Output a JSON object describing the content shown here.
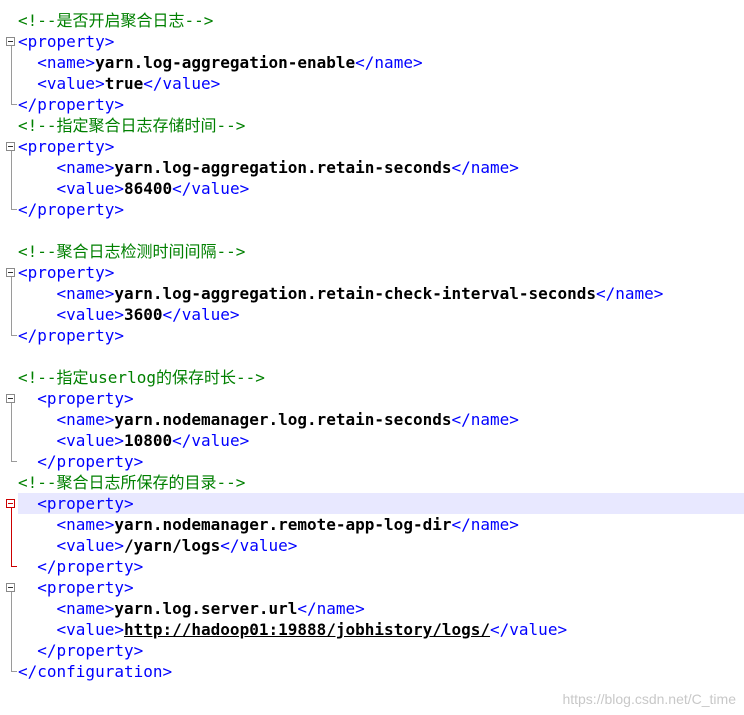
{
  "editor": {
    "lines": [
      {
        "kind": "comment",
        "indent": "",
        "text": "<!--是否开启聚合日志-->"
      },
      {
        "kind": "tag",
        "indent": "",
        "text": "<property>"
      },
      {
        "kind": "element",
        "indent": "  ",
        "open": "<name>",
        "value": "yarn.log-aggregation-enable",
        "close": "</name>"
      },
      {
        "kind": "element",
        "indent": "  ",
        "open": "<value>",
        "value": "true",
        "close": "</value>"
      },
      {
        "kind": "tag",
        "indent": "",
        "text": "</property>"
      },
      {
        "kind": "comment",
        "indent": "",
        "text": "<!--指定聚合日志存储时间-->"
      },
      {
        "kind": "tag",
        "indent": "",
        "text": "<property>"
      },
      {
        "kind": "element",
        "indent": "    ",
        "open": "<name>",
        "value": "yarn.log-aggregation.retain-seconds",
        "close": "</name>"
      },
      {
        "kind": "element",
        "indent": "    ",
        "open": "<value>",
        "value": "86400",
        "close": "</value>"
      },
      {
        "kind": "tag",
        "indent": "",
        "text": "</property>"
      },
      {
        "kind": "blank",
        "indent": "",
        "text": ""
      },
      {
        "kind": "comment",
        "indent": "",
        "text": "<!--聚合日志检测时间间隔-->"
      },
      {
        "kind": "tag",
        "indent": "",
        "text": "<property>"
      },
      {
        "kind": "element",
        "indent": "    ",
        "open": "<name>",
        "value": "yarn.log-aggregation.retain-check-interval-seconds",
        "close": "</name>"
      },
      {
        "kind": "element",
        "indent": "    ",
        "open": "<value>",
        "value": "3600",
        "close": "</value>"
      },
      {
        "kind": "tag",
        "indent": "",
        "text": "</property>"
      },
      {
        "kind": "blank",
        "indent": "",
        "text": ""
      },
      {
        "kind": "comment",
        "indent": "",
        "text": "<!--指定userlog的保存时长-->"
      },
      {
        "kind": "tag",
        "indent": "  ",
        "text": "<property>"
      },
      {
        "kind": "element",
        "indent": "    ",
        "open": "<name>",
        "value": "yarn.nodemanager.log.retain-seconds",
        "close": "</name>"
      },
      {
        "kind": "element",
        "indent": "    ",
        "open": "<value>",
        "value": "10800",
        "close": "</value>"
      },
      {
        "kind": "tag",
        "indent": "  ",
        "text": "</property>"
      },
      {
        "kind": "comment",
        "indent": "",
        "text": "<!--聚合日志所保存的目录-->"
      },
      {
        "kind": "tag",
        "indent": "  ",
        "text": "<property>",
        "highlight": true
      },
      {
        "kind": "element",
        "indent": "    ",
        "open": "<name>",
        "value": "yarn.nodemanager.remote-app-log-dir",
        "close": "</name>"
      },
      {
        "kind": "element",
        "indent": "    ",
        "open": "<value>",
        "value": "/yarn/logs",
        "close": "</value>"
      },
      {
        "kind": "tag",
        "indent": "  ",
        "text": "</property>"
      },
      {
        "kind": "tag",
        "indent": "  ",
        "text": "<property>"
      },
      {
        "kind": "element",
        "indent": "    ",
        "open": "<name>",
        "value": "yarn.log.server.url",
        "close": "</name>"
      },
      {
        "kind": "element",
        "indent": "    ",
        "open": "<value>",
        "value": "http://hadoop01:19888/jobhistory/logs/",
        "close": "</value>",
        "url": true
      },
      {
        "kind": "tag",
        "indent": "  ",
        "text": "</property>"
      },
      {
        "kind": "tag",
        "indent": "",
        "text": "</configuration>"
      }
    ]
  },
  "watermark": "https://blog.csdn.net/C_time",
  "colors": {
    "tag": "#0000ff",
    "comment": "#008000",
    "text": "#000000",
    "highlight": "#e8e8ff",
    "fold_active": "#cc0000"
  }
}
